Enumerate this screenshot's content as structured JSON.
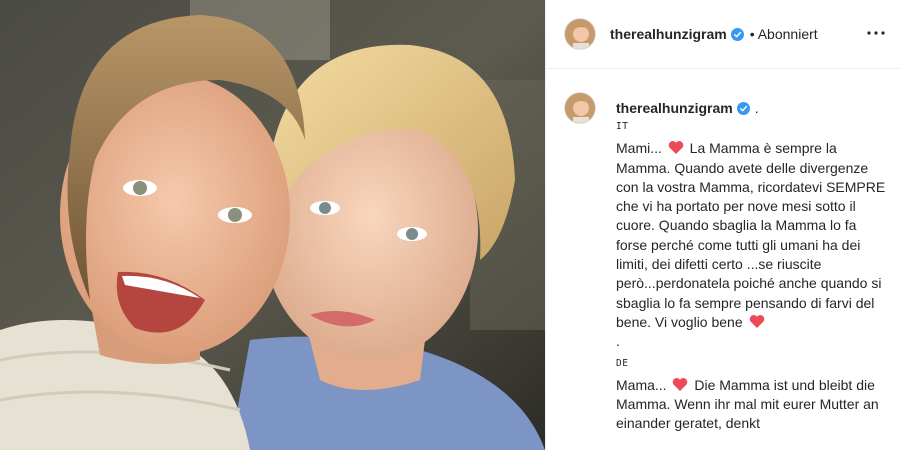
{
  "post": {
    "photo_alt": "selfie of two smiling women",
    "author": "therealhunzigram",
    "follow_status": "• Abonniert",
    "more_icon": "more-options-icon",
    "verified_icon": "verified-badge-icon",
    "accent_color": "#3897f0",
    "heart_color": "#ed4956"
  },
  "caption": {
    "author": "therealhunzigram",
    "suffix": ".",
    "it_lang": "IT",
    "it_start": "Mami...",
    "it_text": "La Mamma è sempre la Mamma. Quando avete delle divergenze con la vostra Mamma, ricordatevi SEMPRE che vi ha portato per nove mesi sotto il cuore. Quando sbaglia la Mamma lo fa forse perché come tutti gli umani ha dei limiti, dei difetti certo ...se riuscite però...perdonatela poiché anche quando si sbaglia lo fa sempre pensando di farvi del bene. Vi voglio bene",
    "it_dot": ".",
    "de_lang": "DE",
    "de_start": "Mama...",
    "de_text": "Die Mamma ist und bleibt die Mamma. Wenn ihr mal mit eurer Mutter an einander geratet, denkt"
  }
}
